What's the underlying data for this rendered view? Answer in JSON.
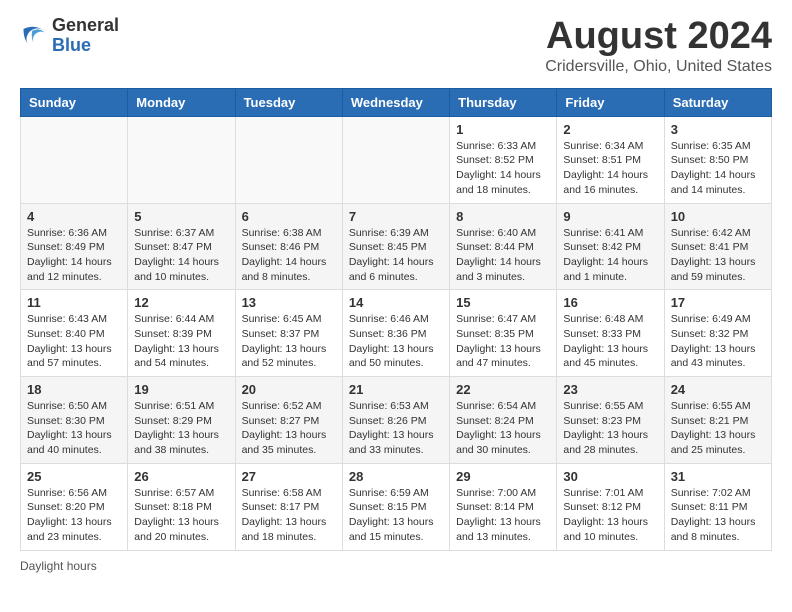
{
  "header": {
    "logo_general": "General",
    "logo_blue": "Blue",
    "main_title": "August 2024",
    "subtitle": "Cridersville, Ohio, United States"
  },
  "calendar": {
    "days_of_week": [
      "Sunday",
      "Monday",
      "Tuesday",
      "Wednesday",
      "Thursday",
      "Friday",
      "Saturday"
    ],
    "weeks": [
      [
        {
          "day": "",
          "info": ""
        },
        {
          "day": "",
          "info": ""
        },
        {
          "day": "",
          "info": ""
        },
        {
          "day": "",
          "info": ""
        },
        {
          "day": "1",
          "info": "Sunrise: 6:33 AM\nSunset: 8:52 PM\nDaylight: 14 hours and 18 minutes."
        },
        {
          "day": "2",
          "info": "Sunrise: 6:34 AM\nSunset: 8:51 PM\nDaylight: 14 hours and 16 minutes."
        },
        {
          "day": "3",
          "info": "Sunrise: 6:35 AM\nSunset: 8:50 PM\nDaylight: 14 hours and 14 minutes."
        }
      ],
      [
        {
          "day": "4",
          "info": "Sunrise: 6:36 AM\nSunset: 8:49 PM\nDaylight: 14 hours and 12 minutes."
        },
        {
          "day": "5",
          "info": "Sunrise: 6:37 AM\nSunset: 8:47 PM\nDaylight: 14 hours and 10 minutes."
        },
        {
          "day": "6",
          "info": "Sunrise: 6:38 AM\nSunset: 8:46 PM\nDaylight: 14 hours and 8 minutes."
        },
        {
          "day": "7",
          "info": "Sunrise: 6:39 AM\nSunset: 8:45 PM\nDaylight: 14 hours and 6 minutes."
        },
        {
          "day": "8",
          "info": "Sunrise: 6:40 AM\nSunset: 8:44 PM\nDaylight: 14 hours and 3 minutes."
        },
        {
          "day": "9",
          "info": "Sunrise: 6:41 AM\nSunset: 8:42 PM\nDaylight: 14 hours and 1 minute."
        },
        {
          "day": "10",
          "info": "Sunrise: 6:42 AM\nSunset: 8:41 PM\nDaylight: 13 hours and 59 minutes."
        }
      ],
      [
        {
          "day": "11",
          "info": "Sunrise: 6:43 AM\nSunset: 8:40 PM\nDaylight: 13 hours and 57 minutes."
        },
        {
          "day": "12",
          "info": "Sunrise: 6:44 AM\nSunset: 8:39 PM\nDaylight: 13 hours and 54 minutes."
        },
        {
          "day": "13",
          "info": "Sunrise: 6:45 AM\nSunset: 8:37 PM\nDaylight: 13 hours and 52 minutes."
        },
        {
          "day": "14",
          "info": "Sunrise: 6:46 AM\nSunset: 8:36 PM\nDaylight: 13 hours and 50 minutes."
        },
        {
          "day": "15",
          "info": "Sunrise: 6:47 AM\nSunset: 8:35 PM\nDaylight: 13 hours and 47 minutes."
        },
        {
          "day": "16",
          "info": "Sunrise: 6:48 AM\nSunset: 8:33 PM\nDaylight: 13 hours and 45 minutes."
        },
        {
          "day": "17",
          "info": "Sunrise: 6:49 AM\nSunset: 8:32 PM\nDaylight: 13 hours and 43 minutes."
        }
      ],
      [
        {
          "day": "18",
          "info": "Sunrise: 6:50 AM\nSunset: 8:30 PM\nDaylight: 13 hours and 40 minutes."
        },
        {
          "day": "19",
          "info": "Sunrise: 6:51 AM\nSunset: 8:29 PM\nDaylight: 13 hours and 38 minutes."
        },
        {
          "day": "20",
          "info": "Sunrise: 6:52 AM\nSunset: 8:27 PM\nDaylight: 13 hours and 35 minutes."
        },
        {
          "day": "21",
          "info": "Sunrise: 6:53 AM\nSunset: 8:26 PM\nDaylight: 13 hours and 33 minutes."
        },
        {
          "day": "22",
          "info": "Sunrise: 6:54 AM\nSunset: 8:24 PM\nDaylight: 13 hours and 30 minutes."
        },
        {
          "day": "23",
          "info": "Sunrise: 6:55 AM\nSunset: 8:23 PM\nDaylight: 13 hours and 28 minutes."
        },
        {
          "day": "24",
          "info": "Sunrise: 6:55 AM\nSunset: 8:21 PM\nDaylight: 13 hours and 25 minutes."
        }
      ],
      [
        {
          "day": "25",
          "info": "Sunrise: 6:56 AM\nSunset: 8:20 PM\nDaylight: 13 hours and 23 minutes."
        },
        {
          "day": "26",
          "info": "Sunrise: 6:57 AM\nSunset: 8:18 PM\nDaylight: 13 hours and 20 minutes."
        },
        {
          "day": "27",
          "info": "Sunrise: 6:58 AM\nSunset: 8:17 PM\nDaylight: 13 hours and 18 minutes."
        },
        {
          "day": "28",
          "info": "Sunrise: 6:59 AM\nSunset: 8:15 PM\nDaylight: 13 hours and 15 minutes."
        },
        {
          "day": "29",
          "info": "Sunrise: 7:00 AM\nSunset: 8:14 PM\nDaylight: 13 hours and 13 minutes."
        },
        {
          "day": "30",
          "info": "Sunrise: 7:01 AM\nSunset: 8:12 PM\nDaylight: 13 hours and 10 minutes."
        },
        {
          "day": "31",
          "info": "Sunrise: 7:02 AM\nSunset: 8:11 PM\nDaylight: 13 hours and 8 minutes."
        }
      ]
    ]
  },
  "footer": {
    "daylight_label": "Daylight hours"
  }
}
